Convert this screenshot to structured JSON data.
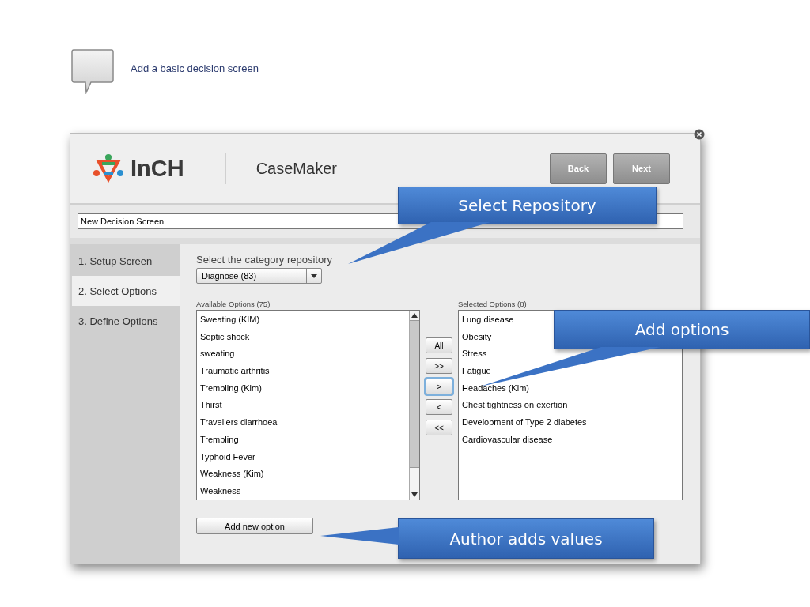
{
  "slide": {
    "heading": "Add a basic decision screen"
  },
  "app": {
    "logo_text": "InCH",
    "product": "CaseMaker",
    "buttons": [
      {
        "label": "Back"
      },
      {
        "label": "Next"
      }
    ]
  },
  "screen_name": {
    "value": "New Decision Screen"
  },
  "steps": [
    {
      "label": "1. Setup Screen",
      "selected": false
    },
    {
      "label": "2. Select Options",
      "selected": true
    },
    {
      "label": "3. Define Options",
      "selected": false
    }
  ],
  "repository": {
    "label": "Select the category repository",
    "value": "Diagnose (83)"
  },
  "available": {
    "title": "Available Options (75)",
    "items": [
      "Sweating (KIM)",
      "Septic shock",
      "sweating",
      "Traumatic arthritis",
      "Trembling (Kim)",
      "Thirst",
      "Travellers diarrhoea",
      "Trembling",
      "Typhoid Fever",
      "Weakness (Kim)",
      "Weakness"
    ]
  },
  "transfer_buttons": [
    {
      "label": "All",
      "focused": false
    },
    {
      "label": ">>",
      "focused": false
    },
    {
      "label": ">",
      "focused": true
    },
    {
      "label": "<",
      "focused": false
    },
    {
      "label": "<<",
      "focused": false
    }
  ],
  "selected": {
    "title": "Selected Options (8)",
    "items": [
      "Lung disease",
      "Obesity",
      "Stress",
      "Fatigue",
      "Headaches (Kim)",
      "Chest tightness on exertion",
      "Development of Type 2 diabetes",
      "Cardiovascular disease"
    ]
  },
  "add_button": {
    "label": "Add new option"
  },
  "callouts": [
    {
      "text": "Select Repository"
    },
    {
      "text": "Add options"
    },
    {
      "text": "Author adds values"
    }
  ]
}
